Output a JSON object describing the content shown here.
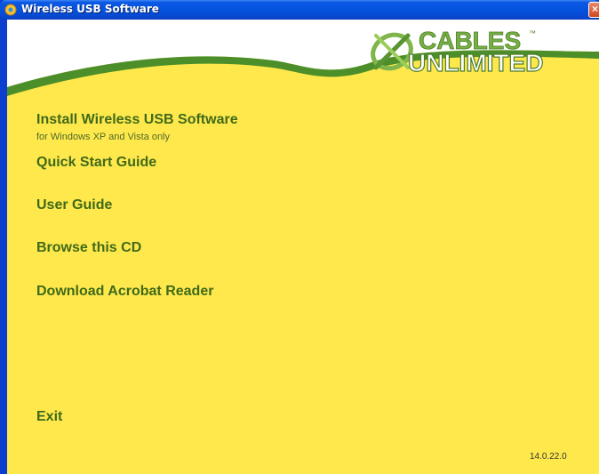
{
  "window": {
    "title": "Wireless USB Software",
    "close_symbol": "×"
  },
  "brand": {
    "line1": "CABLES",
    "trademark": "™",
    "line2": "UNLIMITED"
  },
  "menu": {
    "install_label": "Install Wireless USB Software",
    "install_subtitle": "for Windows XP and Vista only",
    "quick_start_label": "Quick Start Guide",
    "user_guide_label": "User Guide",
    "browse_label": "Browse this CD",
    "acrobat_label": "Download Acrobat Reader",
    "exit_label": "Exit"
  },
  "footer": {
    "version": "14.0.22.0"
  },
  "colors": {
    "background": "#ffe84c",
    "header_white": "#ffffff",
    "green_band": "#4c8f2a",
    "link_text": "#3f6a1a",
    "titlebar": "#0453de"
  }
}
